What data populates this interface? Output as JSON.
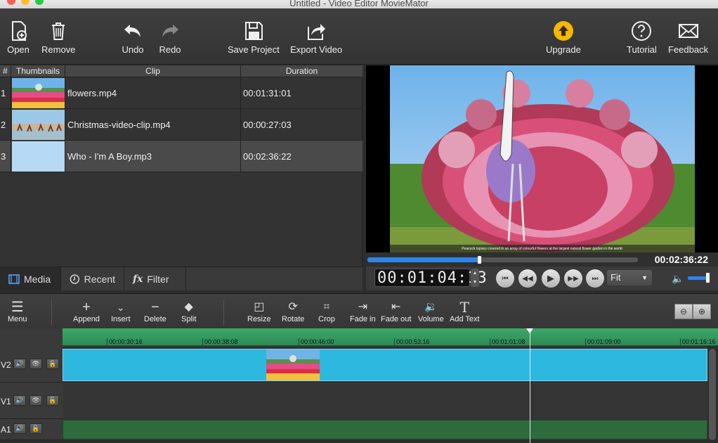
{
  "window": {
    "title": "Untitled - Video Editor MovieMator"
  },
  "toolbar": {
    "open": "Open",
    "remove": "Remove",
    "undo": "Undo",
    "redo": "Redo",
    "save_project": "Save Project",
    "export_video": "Export Video",
    "upgrade": "Upgrade",
    "tutorial": "Tutorial",
    "feedback": "Feedback"
  },
  "clip_list": {
    "headers": {
      "num": "#",
      "thumbnails": "Thumbnails",
      "clip": "Clip",
      "duration": "Duration"
    },
    "rows": [
      {
        "num": "1",
        "name": "flowers.mp4",
        "duration": "00:01:31:01"
      },
      {
        "num": "2",
        "name": "Christmas-video-clip.mp4",
        "duration": "00:00:27:03"
      },
      {
        "num": "3",
        "name": "Who - I'm A Boy.mp3",
        "duration": "00:02:36:22"
      }
    ],
    "selected_index": 2
  },
  "tabs": {
    "media": "Media",
    "recent": "Recent",
    "filter": "Filter"
  },
  "preview": {
    "caption": "Peacock topiary covered in an array of colourful flowers at the largest natural flower garden in the world",
    "progress": 0.41,
    "total_time": "00:02:36:22",
    "current_time": "00:01:04:13",
    "fit": "Fit",
    "volume": 0.9
  },
  "timeline_toolbar": {
    "menu": "Menu",
    "append": "Append",
    "insert": "Insert",
    "delete": "Delete",
    "split": "Split",
    "resize": "Resize",
    "rotate": "Rotate",
    "crop": "Crop",
    "fade_in": "Fade in",
    "fade_out": "Fade out",
    "volume": "Volume",
    "add_text": "Add Text"
  },
  "ruler": {
    "labels": [
      "00:00:30:16",
      "00:00:38:08",
      "00:00:46:00",
      "00:00:53:16",
      "00:01:01:08",
      "00:01:09:00",
      "00:01:16:16"
    ]
  },
  "tracks": {
    "v2": "V2",
    "v1": "V1",
    "a1": "A1"
  },
  "colors": {
    "accent": "#2e84e8",
    "video_clip": "#2db8e0",
    "audio_track": "#2d6b3c",
    "ruler": "#35995f",
    "upgrade": "#f5b800"
  }
}
